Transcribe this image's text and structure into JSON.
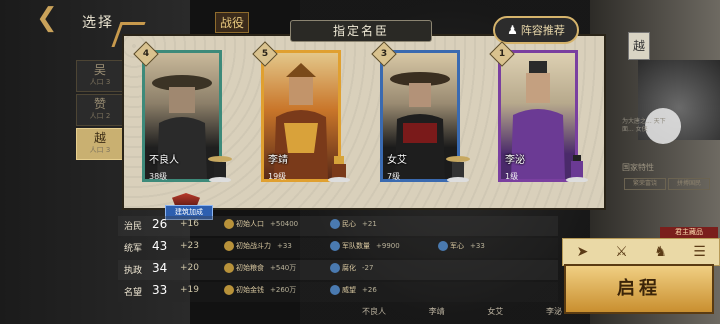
{
  "background": {
    "screen_title": "选择",
    "screen_tab": "战役",
    "clans": [
      {
        "name": "吴",
        "sub": "人口 3"
      },
      {
        "name": "赞",
        "sub": "人口 2"
      },
      {
        "name": "越",
        "sub": "人口 3"
      }
    ],
    "right_panel": {
      "card_char": "越",
      "desc": "为大唐之... 天下面... 女侠",
      "header": "国家特性",
      "chips": [
        "繁荣富饶",
        "拼搏国民"
      ]
    }
  },
  "modal": {
    "title": "指定名臣",
    "recommend_label": "阵容推荐"
  },
  "cards": [
    {
      "rank": "4",
      "name": "不良人",
      "level": "38级",
      "frame_color": "#3d8a7a"
    },
    {
      "rank": "5",
      "name": "李靖",
      "level": "19级",
      "frame_color": "#e0a030"
    },
    {
      "rank": "3",
      "name": "女艾",
      "level": "7级",
      "frame_color": "#3a6ab0"
    },
    {
      "rank": "1",
      "name": "李泌",
      "level": "1级",
      "frame_color": "#7a3fa0"
    }
  ],
  "build_badge": "建筑加成",
  "stats": [
    {
      "name": "治民",
      "value": "26",
      "inc": "+16",
      "buffs": [
        {
          "label": "初始人口",
          "value": "+50400"
        },
        {
          "label": "民心",
          "value": "+21"
        }
      ]
    },
    {
      "name": "统军",
      "value": "43",
      "inc": "+23",
      "buffs": [
        {
          "label": "初始战斗力",
          "value": "+33"
        },
        {
          "label": "军队数量",
          "value": "+9900"
        },
        {
          "label": "军心",
          "value": "+33"
        }
      ]
    },
    {
      "name": "执政",
      "value": "34",
      "inc": "+20",
      "buffs": [
        {
          "label": "初始粮食",
          "value": "+540万"
        },
        {
          "label": "腐化",
          "value": "-27"
        }
      ]
    },
    {
      "name": "名望",
      "value": "33",
      "inc": "+19",
      "buffs": [
        {
          "label": "初始金钱",
          "value": "+260万"
        },
        {
          "label": "威望",
          "value": "+26"
        }
      ]
    }
  ],
  "lord_tag": "君主藏品",
  "start_button": "启程",
  "bottom_names": [
    "不良人",
    "李靖",
    "女艾",
    "李泌"
  ]
}
